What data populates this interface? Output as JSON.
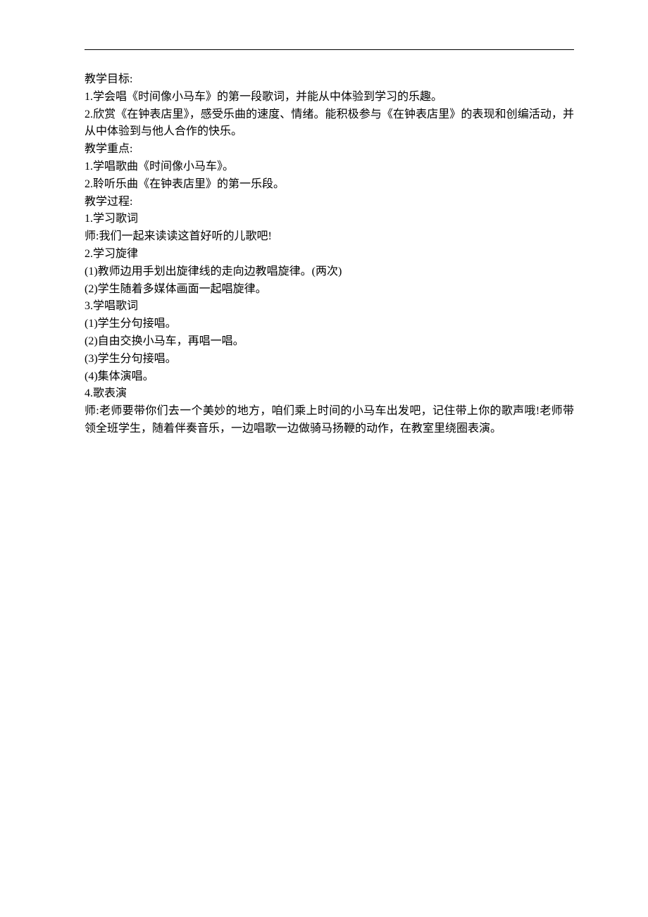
{
  "lines": [
    "教学目标:",
    "1.学会唱《时间像小马车》的第一段歌词，并能从中体验到学习的乐趣。",
    "2.欣赏《在钟表店里》，感受乐曲的速度、情绪。能积极参与《在钟表店里》的表现和创编活动，并从中体验到与他人合作的快乐。",
    "教学重点:",
    "1.学唱歌曲《时间像小马车》。",
    "2.聆听乐曲《在钟表店里》的第一乐段。",
    "教学过程:",
    "1.学习歌词",
    "师:我们一起来读读这首好听的儿歌吧!",
    "2.学习旋律",
    "(1)教师边用手划出旋律线的走向边教唱旋律。(两次)",
    "(2)学生随着多媒体画面一起唱旋律。",
    "3.学唱歌词",
    "(1)学生分句接唱。",
    "(2)自由交换小马车，再唱一唱。",
    "(3)学生分句接唱。",
    "(4)集体演唱。",
    "4.歌表演",
    "师:老师要带你们去一个美妙的地方，咱们乘上时间的小马车出发吧，记住带上你的歌声哦!老师带领全班学生，随着伴奏音乐，一边唱歌一边做骑马扬鞭的动作，在教室里绕圈表演。"
  ]
}
